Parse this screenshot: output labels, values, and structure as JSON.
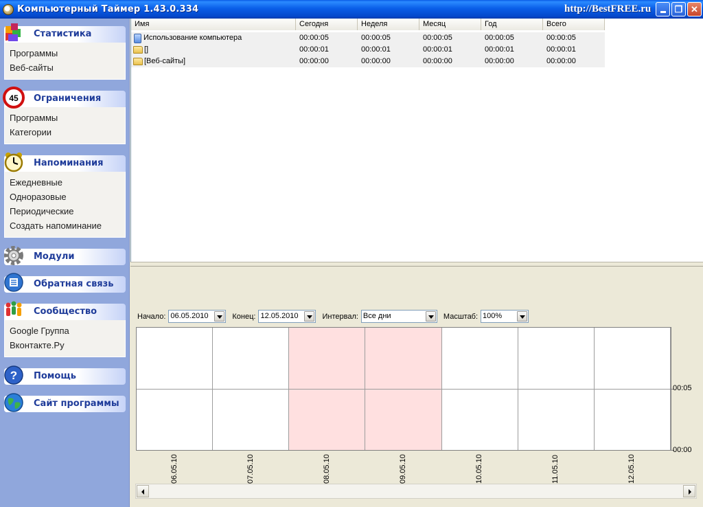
{
  "window": {
    "title": "Компьютерный Таймер 1.43.0.334",
    "site": "http://BestFREE.ru",
    "min_label": "",
    "max_label": "❐",
    "close_label": "✕"
  },
  "sidebar": {
    "statistics": {
      "title": "Статистика",
      "items": [
        "Программы",
        "Веб-сайты"
      ]
    },
    "limits": {
      "title": "Ограничения",
      "items": [
        "Программы",
        "Категории"
      ],
      "badge": "45"
    },
    "reminders": {
      "title": "Напоминания",
      "items": [
        "Ежедневные",
        "Одноразовые",
        "Периодические",
        "Создать напоминание"
      ]
    },
    "modules": {
      "title": "Модули"
    },
    "feedback": {
      "title": "Обратная связь"
    },
    "community": {
      "title": "Сообщество",
      "items": [
        "Google Группа",
        "Вконтакте.Ру"
      ]
    },
    "help": {
      "title": "Помощь"
    },
    "website": {
      "title": "Сайт программы"
    }
  },
  "table": {
    "columns": [
      "Имя",
      "Сегодня",
      "Неделя",
      "Месяц",
      "Год",
      "Всего"
    ],
    "rows": [
      {
        "icon": "computer-icon",
        "name": "Использование компьютера",
        "today": "00:00:05",
        "week": "00:00:05",
        "month": "00:00:05",
        "year": "00:00:05",
        "total": "00:00:05"
      },
      {
        "icon": "folder-icon",
        "name": "[]",
        "today": "00:00:01",
        "week": "00:00:01",
        "month": "00:00:01",
        "year": "00:00:01",
        "total": "00:00:01"
      },
      {
        "icon": "folder-icon",
        "name": "[Веб-сайты]",
        "today": "00:00:00",
        "week": "00:00:00",
        "month": "00:00:00",
        "year": "00:00:00",
        "total": "00:00:00"
      }
    ]
  },
  "filters": {
    "start_label": "Начало:",
    "start_value": "06.05.2010",
    "end_label": "Конец:",
    "end_value": "12.05.2010",
    "interval_label": "Интервал:",
    "interval_value": "Все дни",
    "scale_label": "Масштаб:",
    "scale_value": "100%"
  },
  "chart_data": {
    "type": "bar",
    "categories": [
      "06.05.10",
      "07.05.10",
      "08.05.10",
      "09.05.10",
      "10.05.10",
      "11.05.10",
      "12.05.10"
    ],
    "weekend": [
      false,
      false,
      true,
      true,
      false,
      false,
      false
    ],
    "values": [
      0,
      0,
      0,
      0,
      0,
      0,
      0
    ],
    "y_ticks": [
      "00:05",
      "00:00"
    ],
    "grid": true
  },
  "colors": {
    "titlebar": "#0a5fe8",
    "sidebar_bg": "#90a7dc",
    "group_title": "#1f3c9a",
    "weekend_fill": "#ffe0e0"
  }
}
